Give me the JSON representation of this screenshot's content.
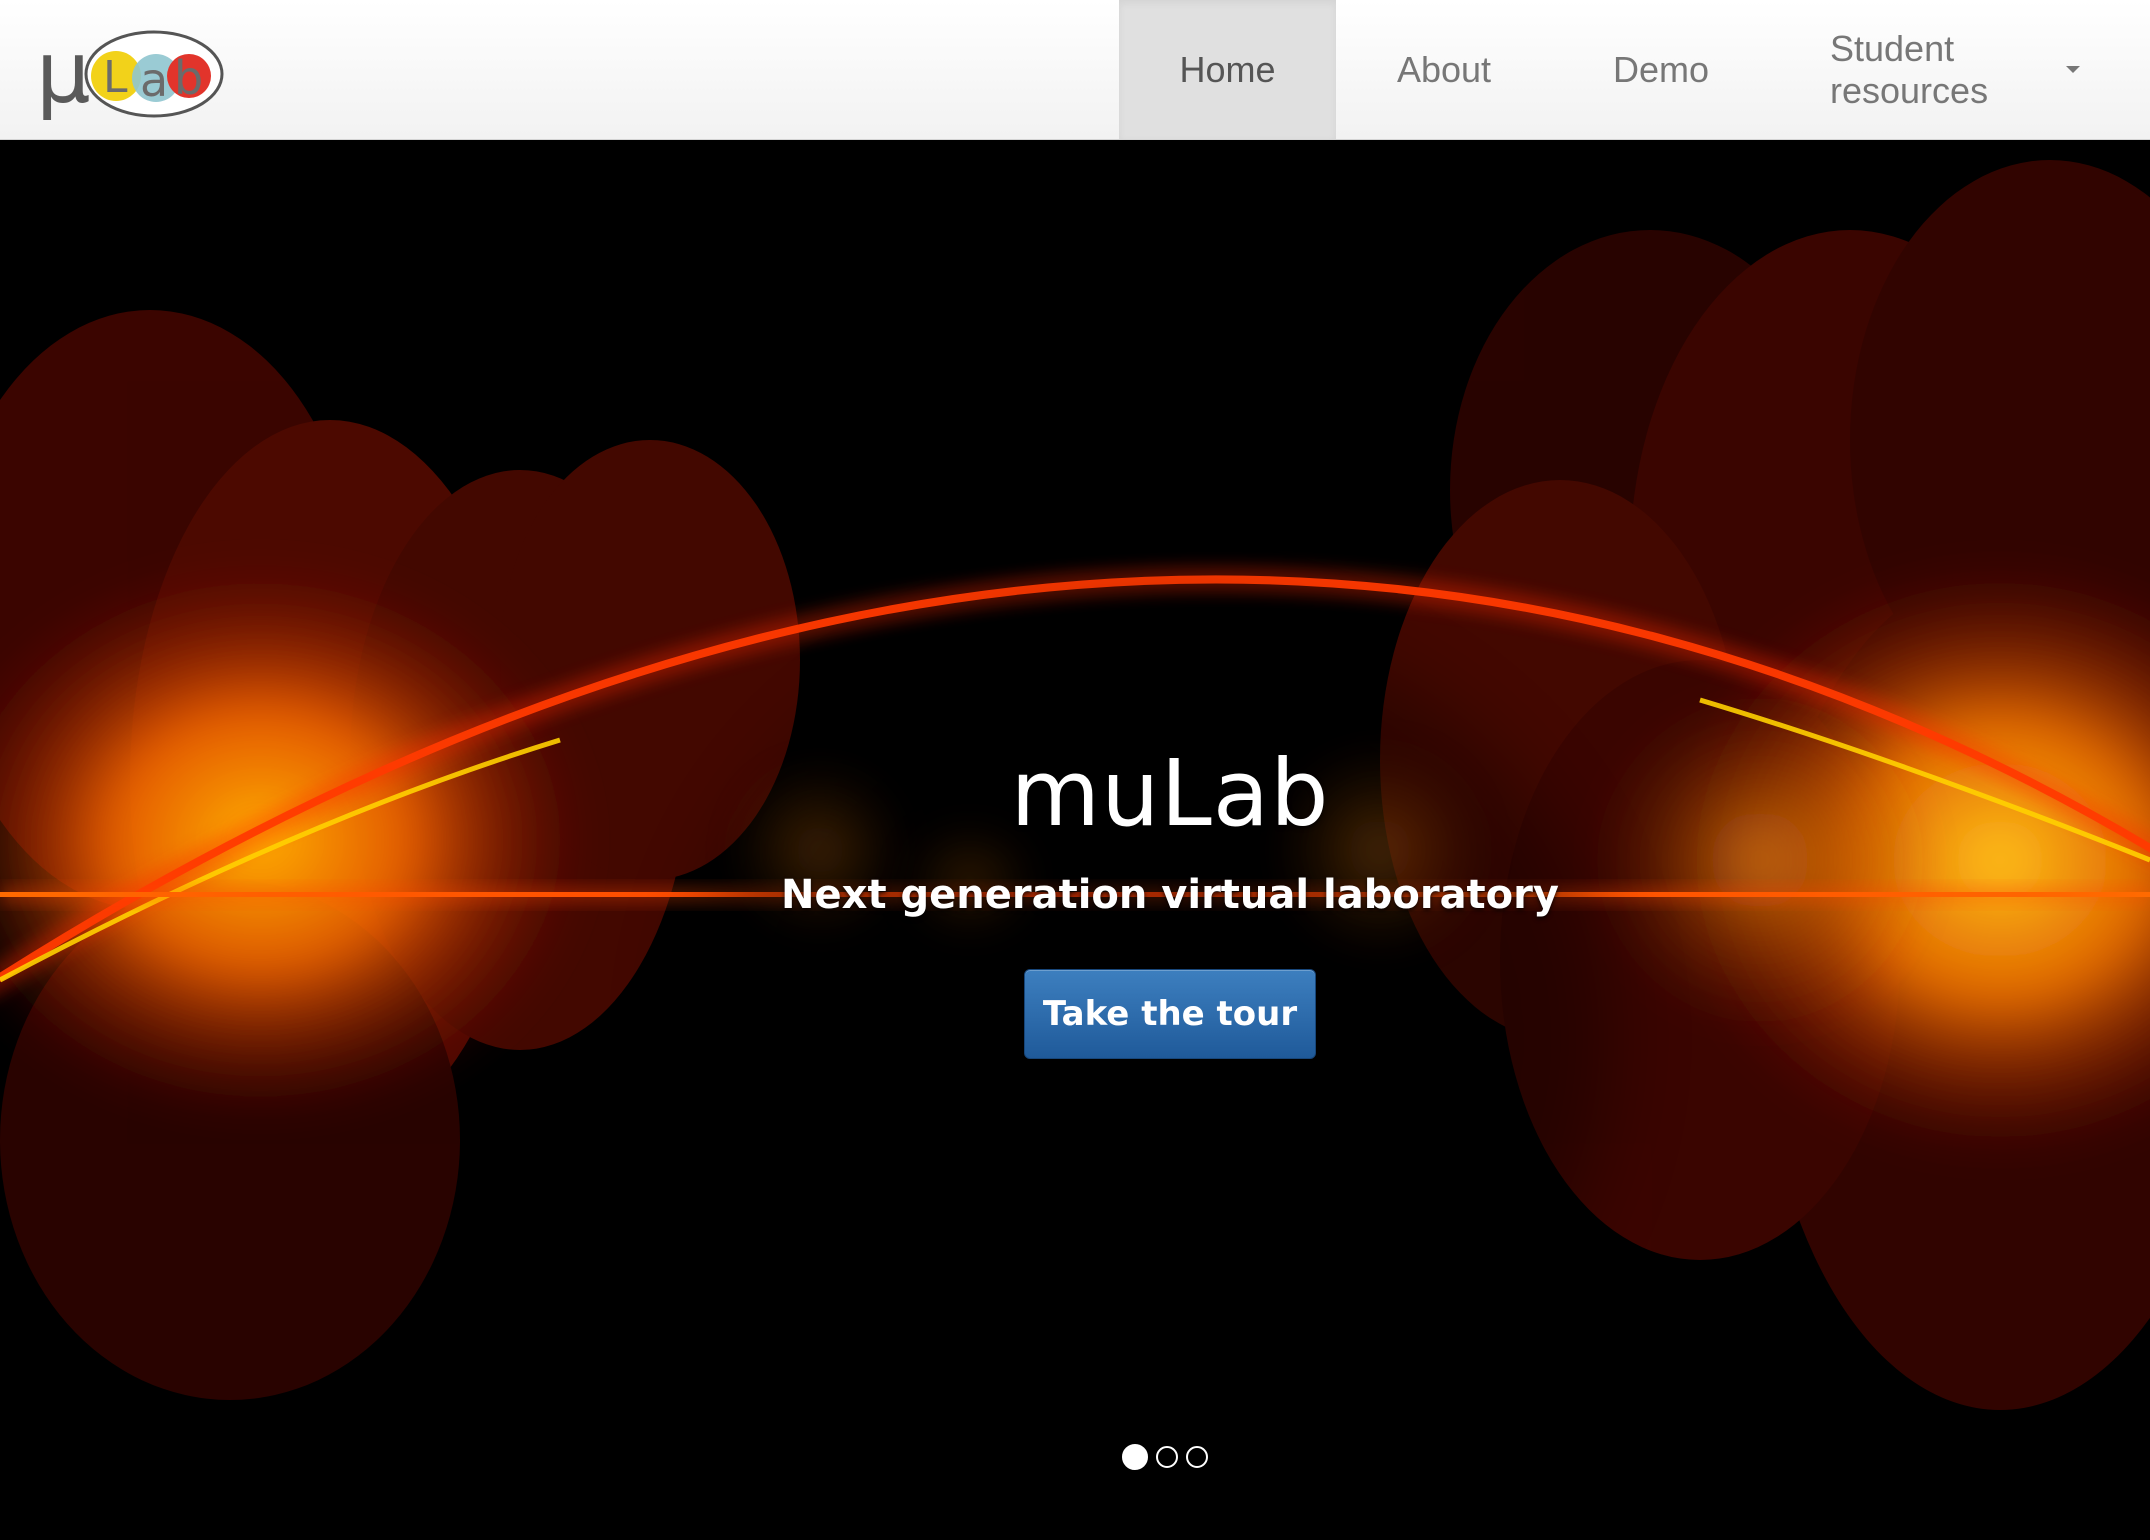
{
  "brand": {
    "logo_text": "μLab",
    "colors": {
      "mu": "#5a5a5a",
      "L_bg": "#f2d21a",
      "a_bg": "#8fc5cf",
      "b_bg": "#e2342b",
      "oval_stroke": "#555555"
    }
  },
  "nav": {
    "items": [
      {
        "label": "Home",
        "active": true
      },
      {
        "label": "About",
        "active": false
      },
      {
        "label": "Demo",
        "active": false
      },
      {
        "label": "Student resources",
        "active": false,
        "has_dropdown": true
      }
    ]
  },
  "hero": {
    "title": "muLab",
    "subtitle": "Next generation virtual laboratory",
    "cta_label": "Take the tour",
    "slides_count": 3,
    "active_slide": 1,
    "colors": {
      "background": "#000000",
      "glow": "#ff8a00",
      "arc": "#ff3a00",
      "button": "#2a6db0"
    }
  }
}
